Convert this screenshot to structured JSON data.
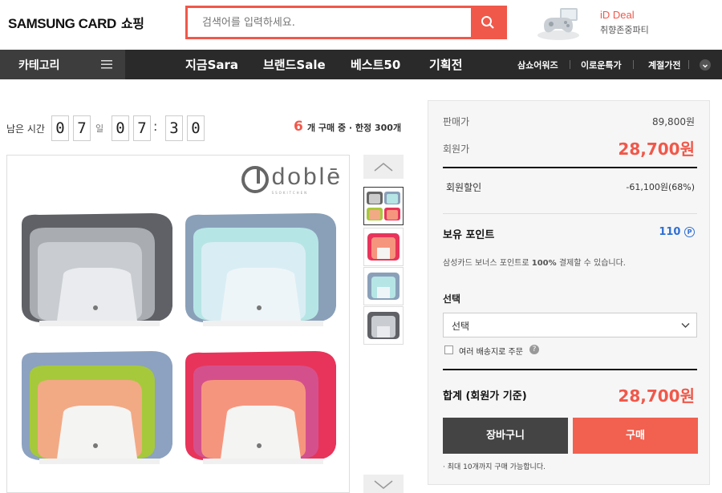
{
  "header": {
    "logo": "SAMSUNG CARD",
    "logo_suffix": "쇼핑",
    "search_placeholder": "검색어를 입력하세요.",
    "promo_title": "iD Deal",
    "promo_subtitle": "취향존중파티"
  },
  "nav": {
    "category_label": "카테고리",
    "main_items": [
      "지금Sara",
      "브랜드Sale",
      "베스트50",
      "기획전"
    ],
    "sub_items": [
      "삼쇼어워즈",
      "이로운특가",
      "계절가전"
    ]
  },
  "timer": {
    "label": "남은 시간",
    "day_digits": [
      "0",
      "7"
    ],
    "day_unit": "일",
    "hour_digits": [
      "0",
      "7"
    ],
    "minute_digits": [
      "3",
      "0"
    ],
    "separator": ":",
    "buy_count": "6",
    "buy_text": "개 구매 중 · 한정 300개"
  },
  "product": {
    "brand": "doblē",
    "brand_sub": "SSOKITCHEN",
    "board_colors": [
      [
        "#5f6166",
        "#a9adb2",
        "#c9ccd0",
        "#e9ebee"
      ],
      [
        "#8aa0b9",
        "#b6e5e5",
        "#d9eef4",
        "#eef5f8"
      ],
      [
        "#8ca2c0",
        "#a6c93b",
        "#f2aa85",
        "#f4f4f2"
      ],
      [
        "#e8345a",
        "#d4508d",
        "#f6957d",
        "#f4f4f2"
      ]
    ]
  },
  "price": {
    "sale_label": "판매가",
    "sale_value": "89,800원",
    "member_label": "회원가",
    "member_value": "28,700원",
    "discount_label": "회원할인",
    "discount_value": "-61,100원(68%)",
    "point_label": "보유 포인트",
    "point_value": "110",
    "point_icon": "P",
    "point_note_prefix": "삼성카드 보너스 포인트로",
    "point_note_pct": "100%",
    "point_note_suffix": "결제할 수 있습니다.",
    "option_label": "선택",
    "option_selected": "선택",
    "multi_ship_label": "여러 배송지로 주문",
    "total_label": "합계 (회원가 기준)",
    "total_value": "28,700원",
    "cart_button": "장바구니",
    "buy_button": "구매",
    "limit_note": "· 최대 10개까지 구매 가능합니다."
  },
  "colors": {
    "accent": "#f0584a",
    "nav_bg": "#2a2a2a",
    "cart_bg": "#444444"
  }
}
